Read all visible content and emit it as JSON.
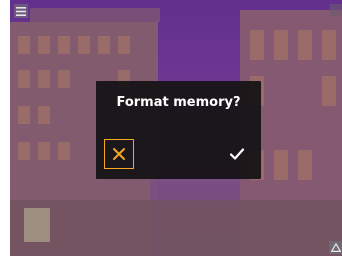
{
  "dialog": {
    "title": "Format memory?",
    "cancel_icon": "close-icon",
    "confirm_icon": "check-icon",
    "accent_color": "#f5a623"
  },
  "overlay": {
    "menu_icon": "menu-icon",
    "warning_icon": "warning-icon"
  }
}
